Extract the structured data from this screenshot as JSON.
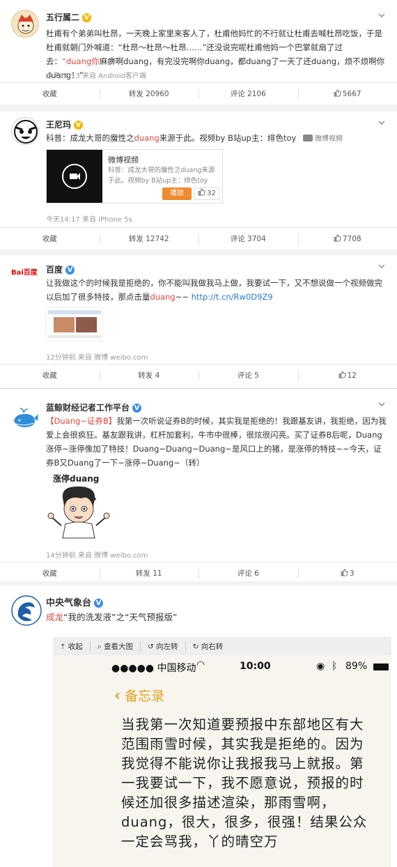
{
  "posts": [
    {
      "name": "五行属二",
      "body_a": "杜甫有个弟弟叫杜昂，一天晚上家里来客人了，杜甫他妈忙的不行就让杜甫去喊杜昂吃饭，于是杜甫就朝门外喊道：“杜昂～杜昂～杜昂……”还没说完呢杜甫他妈一个巴掌就扇了过去：",
      "body_hl": "“duang你",
      "body_b": "麻痹啊duang，有完没完啊你duang，都duang了一天了还duang，烦不烦啊你duang！”",
      "meta": "今天15:13 来自 Android客户端",
      "collect": "收藏",
      "repost": "转发 20960",
      "comment": "评论 2106",
      "like": "5667"
    },
    {
      "name": "王尼玛",
      "body_a": "科普：成龙大哥的魔性之",
      "body_hl": "duang",
      "body_b": "来源于此。视频by B站up主：绯色toy",
      "video_tag": "微博视频",
      "card_title": "微博视频",
      "card_desc": "科普：成龙大哥的魔性之duang来源于此。视频by B站up主：绯色toy",
      "card_play": "播放",
      "card_like": "32",
      "meta": "今天14:17 来自 iPhone 5s",
      "collect": "收藏",
      "repost": "转发 12742",
      "comment": "评论 3704",
      "like": "7708"
    },
    {
      "name": "百度",
      "logo": "Bai百度",
      "body_a": "让我做这个的时候我是拒绝的，你不能叫我做我马上做，我要试一下，又不想说做一个视频做完以后加了很多特技，那点击量",
      "body_hl": "duang",
      "body_b": "~~ ",
      "body_link": "http://t.cn/Rw0D9Z9",
      "meta": "12分钟前 来自 微博 weibo.com",
      "collect": "收藏",
      "repost": "转发 4",
      "comment": "评论 5",
      "like": "12"
    },
    {
      "name": "蓝鲸财经记者工作平台",
      "body_hl": "【Duang~证券B】",
      "body_b": "我第一次听说证券B的时候，其实我是拒绝的！我跟基友讲，我拒绝，因为我爱上会很疯狂。基友跟我讲，杠杆加套利，牛市中很棒，很炫很闪亮。买了证券B后呢，Duang涨停~涨停像加了特技！Duang~Duang~Duang~是风口上的猪，是涨停的特技~~今天，证券B又Duang了一下~涨停~Duang~（转）",
      "img_text": "涨停duang",
      "meta": "14分钟前 来自 微博 weibo.com",
      "collect": "收藏",
      "repost": "转发 11",
      "comment": "评论 6",
      "like": "3"
    },
    {
      "name": "中央气象台",
      "body_hl": "成龙",
      "body_b": "“我的洗发液”之“天气预报版”"
    }
  ],
  "viewer": {
    "collapse": "收起",
    "view_large": "查看大图",
    "rotate_left": "向左转",
    "rotate_right": "向右转"
  },
  "phone": {
    "carrier": "●●●●● 中国移动",
    "time": "10:00",
    "battery": "89%",
    "back_label": "备忘录",
    "memo_text": "当我第一次知道要预报中东部地区有大范围雨雪时候，其实我是拒绝的。因为我觉得不能说你让我报我马上就报。第一我要试一下，我不愿意说，预报的时候还加很多描述渲染，那雨雪啊，duang，很大，很多，很强！结果公众一定会骂我，丫的晴空万"
  },
  "colors": {
    "highlight": "#e1453b",
    "link": "#2a7bd0",
    "orange": "#f08a2e",
    "verified_gold": "#f7b500",
    "verified_blue": "#3a8ee6",
    "memo_bg": "#f7f5ee",
    "memo_accent": "#e4a11b"
  }
}
